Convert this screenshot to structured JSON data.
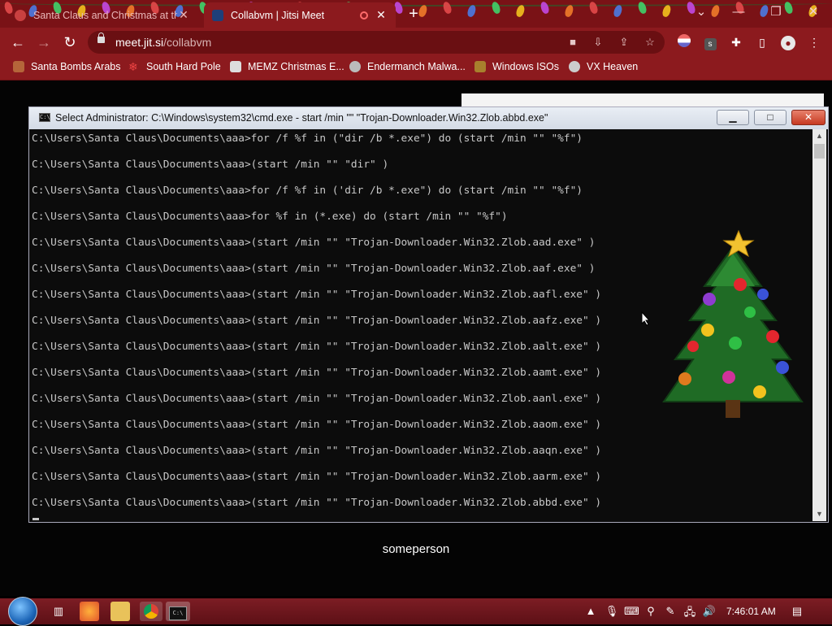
{
  "browser": {
    "tabs": [
      {
        "title": "Santa Claus and Christmas at th",
        "close": "✕"
      },
      {
        "title": "Collabvm | Jitsi Meet",
        "close": "✕"
      }
    ],
    "new_tab": "+",
    "url_host": "meet.jit.si",
    "url_path": "/collabvm",
    "bookmarks": [
      "Santa Bombs Arabs",
      "South Hard Pole",
      "MEMZ Christmas E...",
      "Endermanch Malwa...",
      "Windows ISOs",
      "VX Heaven"
    ],
    "accent": "#8c1a1e"
  },
  "cmd": {
    "title": "Select Administrator: C:\\Windows\\system32\\cmd.exe - start  /min \"\" \"Trojan-Downloader.Win32.Zlob.abbd.exe\"",
    "icon_text": "C:\\",
    "lines": [
      "C:\\Users\\Santa Claus\\Documents\\aaa>for /f %f in (\"dir /b *.exe\") do (start /min \"\" \"%f\")",
      "C:\\Users\\Santa Claus\\Documents\\aaa>(start /min \"\" \"dir\" )",
      "C:\\Users\\Santa Claus\\Documents\\aaa>for /f %f in ('dir /b *.exe\") do (start /min \"\" \"%f\")",
      "C:\\Users\\Santa Claus\\Documents\\aaa>for %f in (*.exe) do (start /min \"\" \"%f\")",
      "C:\\Users\\Santa Claus\\Documents\\aaa>(start /min \"\" \"Trojan-Downloader.Win32.Zlob.aad.exe\" )",
      "C:\\Users\\Santa Claus\\Documents\\aaa>(start /min \"\" \"Trojan-Downloader.Win32.Zlob.aaf.exe\" )",
      "C:\\Users\\Santa Claus\\Documents\\aaa>(start /min \"\" \"Trojan-Downloader.Win32.Zlob.aafl.exe\" )",
      "C:\\Users\\Santa Claus\\Documents\\aaa>(start /min \"\" \"Trojan-Downloader.Win32.Zlob.aafz.exe\" )",
      "C:\\Users\\Santa Claus\\Documents\\aaa>(start /min \"\" \"Trojan-Downloader.Win32.Zlob.aalt.exe\" )",
      "C:\\Users\\Santa Claus\\Documents\\aaa>(start /min \"\" \"Trojan-Downloader.Win32.Zlob.aamt.exe\" )",
      "C:\\Users\\Santa Claus\\Documents\\aaa>(start /min \"\" \"Trojan-Downloader.Win32.Zlob.aanl.exe\" )",
      "C:\\Users\\Santa Claus\\Documents\\aaa>(start /min \"\" \"Trojan-Downloader.Win32.Zlob.aaom.exe\" )",
      "C:\\Users\\Santa Claus\\Documents\\aaa>(start /min \"\" \"Trojan-Downloader.Win32.Zlob.aaqn.exe\" )",
      "C:\\Users\\Santa Claus\\Documents\\aaa>(start /min \"\" \"Trojan-Downloader.Win32.Zlob.aarm.exe\" )",
      "C:\\Users\\Santa Claus\\Documents\\aaa>(start /min \"\" \"Trojan-Downloader.Win32.Zlob.abbd.exe\" )"
    ]
  },
  "meeting": {
    "participant_name": "someperson"
  },
  "taskbar": {
    "clock": "7:46:01 AM"
  }
}
